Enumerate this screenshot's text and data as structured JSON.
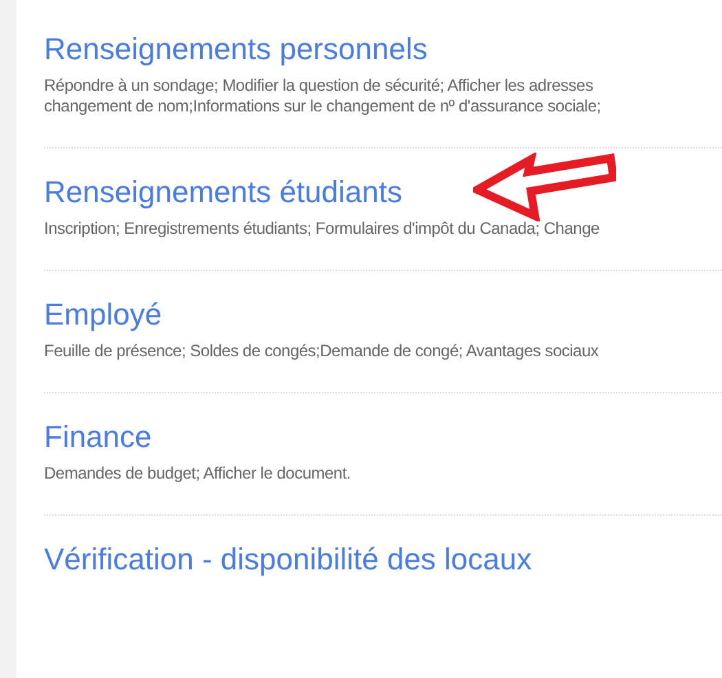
{
  "sections": [
    {
      "title": "Renseignements personnels",
      "lines": [
        "Répondre à un sondage; Modifier la question de sécurité; Afficher les adresses",
        "changement de nom;Informations sur le changement de nº d'assurance sociale;"
      ],
      "highlighted": false
    },
    {
      "title": "Renseignements étudiants",
      "lines": [
        "Inscription; Enregistrements étudiants; Formulaires d'impôt du Canada; Change"
      ],
      "highlighted": true
    },
    {
      "title": "Employé",
      "lines": [
        "Feuille de présence; Soldes de congés;Demande de congé; Avantages sociaux"
      ],
      "highlighted": false
    },
    {
      "title": "Finance",
      "lines": [
        "Demandes de budget; Afficher le document."
      ],
      "highlighted": false
    },
    {
      "title": "Vérification - disponibilité des locaux",
      "highlighted": false
    }
  ]
}
